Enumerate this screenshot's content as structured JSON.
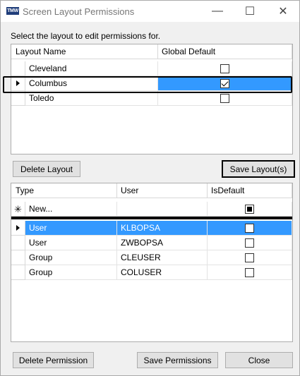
{
  "window": {
    "app_icon_text": "TMW",
    "title": "Screen Layout Permissions",
    "minimize": "—",
    "maximize": "☐",
    "close": "✕"
  },
  "prompt": "Select the layout to edit permissions for.",
  "layouts_grid": {
    "columns": [
      "Layout Name",
      "Global Default"
    ],
    "rows": [
      {
        "name": "Cleveland",
        "global_default": false
      },
      {
        "name": "Columbus",
        "global_default": true,
        "selected": true
      },
      {
        "name": "Toledo",
        "global_default": false
      }
    ]
  },
  "buttons": {
    "delete_layout": "Delete Layout",
    "save_layouts": "Save Layout(s)",
    "delete_permission": "Delete Permission",
    "save_permissions": "Save Permissions",
    "close": "Close"
  },
  "permissions_grid": {
    "columns": [
      "Type",
      "User",
      "IsDefault"
    ],
    "new_row_label": "New...",
    "rows": [
      {
        "type": "User",
        "user": "KLBOPSA",
        "is_default": false,
        "selected": true
      },
      {
        "type": "User",
        "user": "ZWBOPSA",
        "is_default": false
      },
      {
        "type": "Group",
        "user": "CLEUSER",
        "is_default": false
      },
      {
        "type": "Group",
        "user": "COLUSER",
        "is_default": false
      }
    ]
  },
  "colors": {
    "selection": "#3399ff",
    "title_text": "#777777",
    "background": "#f0f0f0"
  },
  "icons": {
    "row_indicator": "triangle-right-icon",
    "new_row": "asterisk-icon"
  }
}
